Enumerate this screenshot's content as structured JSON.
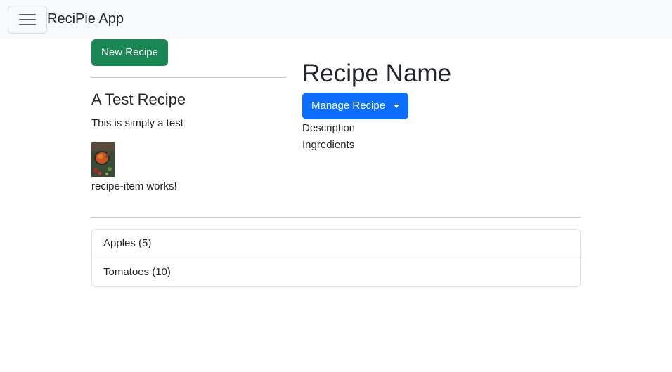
{
  "navbar": {
    "brand": "ReciPie App",
    "toggler_icon": "hamburger-menu-icon"
  },
  "recipe_list": {
    "new_recipe_label": "New Recipe",
    "items": [
      {
        "title": "A Test Recipe",
        "description": "This is simply a test",
        "image_icon": "recipe-thumbnail-image"
      }
    ],
    "footer_text": "recipe-item works!"
  },
  "recipe_detail": {
    "title": "Recipe Name",
    "manage_label": "Manage Recipe",
    "description_label": "Description",
    "ingredients_label": "Ingredients"
  },
  "shopping_list": {
    "items": [
      {
        "label": "Apples (5)"
      },
      {
        "label": "Tomatoes (10)"
      }
    ]
  },
  "colors": {
    "navbar_bg": "#f8f9fa",
    "success": "#198754",
    "primary": "#0d6efd",
    "border": "#dee2e6"
  }
}
